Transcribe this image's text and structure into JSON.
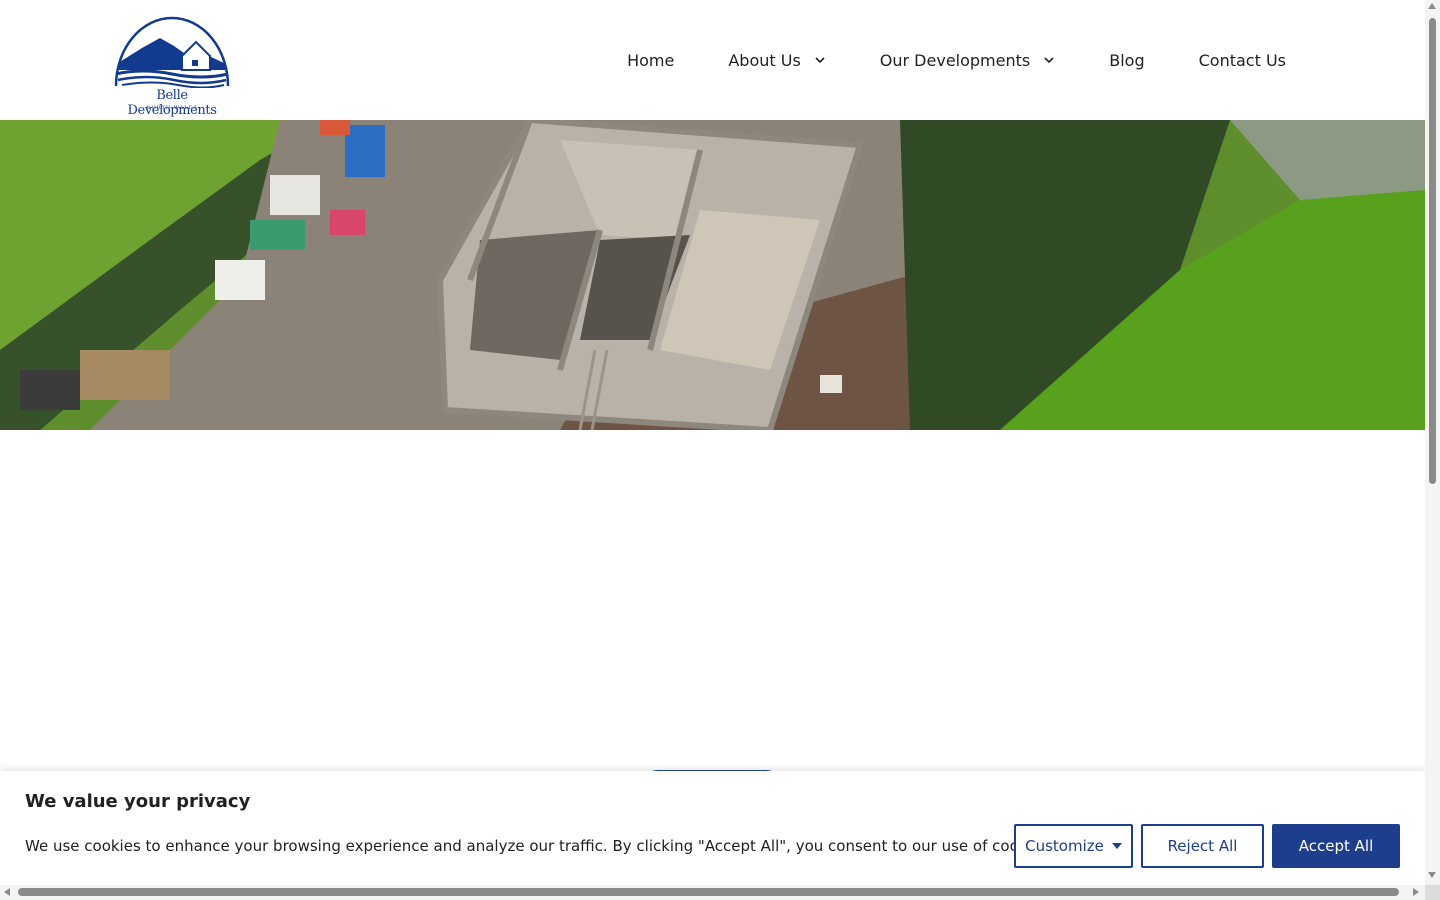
{
  "brand": {
    "name": "Belle Developments",
    "sub": "NORTH WALES",
    "color": "#123a8e"
  },
  "nav": {
    "items": [
      {
        "label": "Home",
        "has_dropdown": false
      },
      {
        "label": "About Us",
        "has_dropdown": true
      },
      {
        "label": "Our Developments",
        "has_dropdown": true
      },
      {
        "label": "Blog",
        "has_dropdown": false
      },
      {
        "label": "Contact Us",
        "has_dropdown": false
      }
    ]
  },
  "hero": {
    "image": "aerial-construction-site-photo"
  },
  "cookie": {
    "title": "We value your privacy",
    "text": "We use cookies to enhance your browsing experience and analyze our traffic. By clicking \"Accept All\", you consent to our use of cookies.",
    "customize_label": "Customize",
    "reject_label": "Reject All",
    "accept_label": "Accept All",
    "accent": "#1c3e8c"
  }
}
